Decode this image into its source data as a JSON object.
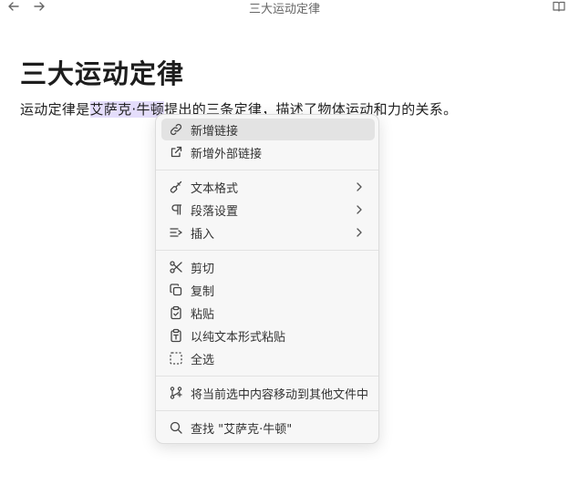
{
  "window": {
    "title": "三大运动定律",
    "back_icon": "arrow-left-icon",
    "forward_icon": "arrow-right-icon",
    "reader_icon": "book-open-icon"
  },
  "document": {
    "heading": "三大运动定律",
    "paragraph": {
      "before": "运动定律是",
      "selected": "艾萨克·牛顿",
      "after": "提出的三条定律，描述了物体运动和力的关系。"
    }
  },
  "watermark": {
    "text": "",
    "color": "#f2f2f2"
  },
  "context_menu": {
    "groups": [
      {
        "items": [
          {
            "label": "新增链接",
            "icon": "link-icon",
            "highlighted": true
          },
          {
            "label": "新增外部链接",
            "icon": "external-link-icon"
          }
        ]
      },
      {
        "items": [
          {
            "label": "文本格式",
            "icon": "paintbrush-icon",
            "submenu": true
          },
          {
            "label": "段落设置",
            "icon": "pilcrow-icon",
            "submenu": true
          },
          {
            "label": "插入",
            "icon": "insert-list-icon",
            "submenu": true
          }
        ]
      },
      {
        "items": [
          {
            "label": "剪切",
            "icon": "scissors-icon"
          },
          {
            "label": "复制",
            "icon": "copy-icon"
          },
          {
            "label": "粘贴",
            "icon": "clipboard-check-icon"
          },
          {
            "label": "以纯文本形式粘贴",
            "icon": "clipboard-type-icon"
          },
          {
            "label": "全选",
            "icon": "select-all-icon"
          }
        ]
      },
      {
        "items": [
          {
            "label": "将当前选中内容移动到其他文件中",
            "icon": "git-fork-icon"
          }
        ]
      },
      {
        "items": [
          {
            "label": "查找 \"艾萨克·牛顿\"",
            "icon": "search-icon"
          }
        ]
      }
    ]
  },
  "colors": {
    "selection": "#e4ddfb",
    "menu_background": "#f7f7f7",
    "menu_item_hover": "#e3e3e3"
  }
}
